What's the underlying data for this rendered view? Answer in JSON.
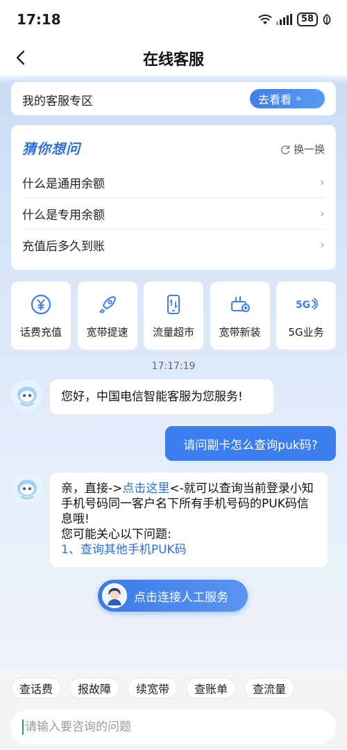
{
  "status_bar": {
    "time": "17:18",
    "battery": "58"
  },
  "nav": {
    "title": "在线客服"
  },
  "zone": {
    "title": "我的客服专区",
    "button": "去看看",
    "button_arrow": "»"
  },
  "guess": {
    "title": "猜你想问",
    "refresh": "换一换",
    "items": [
      {
        "label": "什么是通用余额"
      },
      {
        "label": "什么是专用余额"
      },
      {
        "label": "充值后多久到账"
      }
    ]
  },
  "services": [
    {
      "label": "话费充值",
      "icon": "yuan-coin-icon"
    },
    {
      "label": "宽带提速",
      "icon": "rocket-icon"
    },
    {
      "label": "流量超市",
      "icon": "phone-data-icon"
    },
    {
      "label": "宽带新装",
      "icon": "router-icon"
    },
    {
      "label": "5G业务",
      "icon": "5g-icon"
    }
  ],
  "chat": {
    "timestamp": "17:17:19",
    "greeting": "您好，中国电信智能客服为您服务!",
    "user_message": "请问副卡怎么查询puk码?",
    "answer": {
      "prefix": "亲，直接->",
      "link": "点击这里",
      "suffix": "<-就可以查询当前登录小知手机号码同一客户名下所有手机号码的PUK码信息哦!",
      "related_title": "您可能关心以下问题:",
      "related_link": "1、查询其他手机PUK码"
    },
    "human_button": "点击连接人工服务"
  },
  "quick_tags": [
    "查话费",
    "报故障",
    "续宽带",
    "查账单",
    "查流量"
  ],
  "input": {
    "placeholder": "请输入要咨询的问题"
  },
  "colors": {
    "accent": "#3b7ef0",
    "link": "#2f6fe0"
  }
}
